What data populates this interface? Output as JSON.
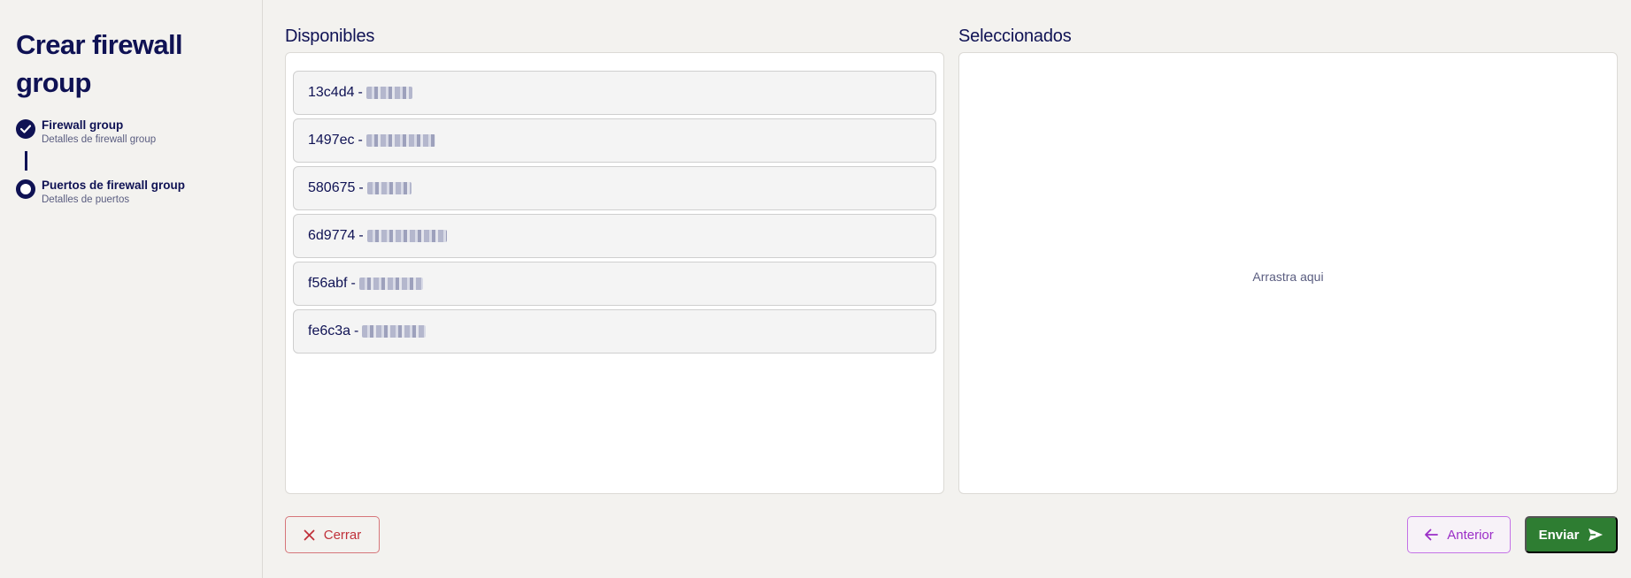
{
  "sidebar": {
    "title": "Crear firewall group",
    "steps": [
      {
        "title": "Firewall group",
        "subtitle": "Detalles de firewall group",
        "status": "done"
      },
      {
        "title": "Puertos de firewall group",
        "subtitle": "Detalles de puertos",
        "status": "current"
      }
    ]
  },
  "available": {
    "label": "Disponibles",
    "items": [
      {
        "id": "13c4d4",
        "sep": "-",
        "name": ""
      },
      {
        "id": "1497ec",
        "sep": "-",
        "name": ""
      },
      {
        "id": "580675",
        "sep": "-",
        "name": ""
      },
      {
        "id": "6d9774",
        "sep": "-",
        "name": ""
      },
      {
        "id": "f56abf",
        "sep": "-",
        "name": ""
      },
      {
        "id": "fe6c3a",
        "sep": "-",
        "name": ""
      }
    ]
  },
  "selected": {
    "label": "Seleccionados",
    "placeholder": "Arrastra aqui"
  },
  "footer": {
    "close_label": "Cerrar",
    "prev_label": "Anterior",
    "send_label": "Enviar"
  },
  "icons": {
    "check": "check-icon",
    "close": "close-icon",
    "back": "arrow-left-icon",
    "send": "send-icon"
  },
  "colors": {
    "primary": "#0f1254",
    "danger": "#c0313a",
    "secondary": "#9b2ec7",
    "success": "#2e7d32"
  }
}
